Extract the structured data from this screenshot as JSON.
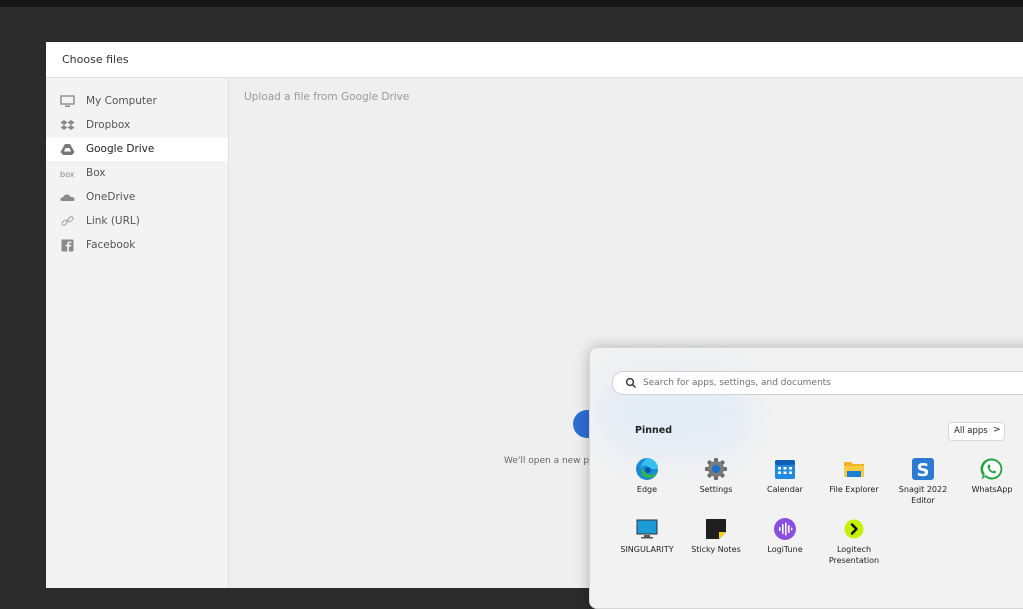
{
  "dialog": {
    "title": "Choose files",
    "sidebar": [
      {
        "label": "My Computer",
        "icon": "monitor-icon"
      },
      {
        "label": "Dropbox",
        "icon": "dropbox-icon"
      },
      {
        "label": "Google Drive",
        "icon": "google-drive-icon",
        "active": true
      },
      {
        "label": "Box",
        "icon": "box-icon"
      },
      {
        "label": "OneDrive",
        "icon": "onedrive-icon"
      },
      {
        "label": "Link (URL)",
        "icon": "link-icon"
      },
      {
        "label": "Facebook",
        "icon": "facebook-icon"
      }
    ],
    "content_title": "Upload a file from Google Drive",
    "open_note": "We'll open a new pa"
  },
  "start_menu": {
    "search_placeholder": "Search for apps, settings, and documents",
    "pinned_label": "Pinned",
    "all_apps_label": "All apps",
    "all_apps_chevron": ">",
    "apps": [
      {
        "label": "Edge",
        "icon": "edge-icon"
      },
      {
        "label": "Settings",
        "icon": "settings-gear-icon"
      },
      {
        "label": "Calendar",
        "icon": "calendar-icon"
      },
      {
        "label": "File Explorer",
        "icon": "folder-icon"
      },
      {
        "label": "Snagit 2022 Editor",
        "icon": "snagit-icon"
      },
      {
        "label": "WhatsApp",
        "icon": "whatsapp-icon"
      },
      {
        "label": "SINGULARITY",
        "icon": "monitor-app-icon"
      },
      {
        "label": "Sticky Notes",
        "icon": "sticky-notes-icon"
      },
      {
        "label": "LogiTune",
        "icon": "logitune-icon"
      },
      {
        "label": "Logitech Presentation",
        "icon": "logitech-presentation-icon"
      }
    ]
  },
  "colors": {
    "accent_blue": "#2f6dd6",
    "active_item_bg": "#ffffff"
  }
}
